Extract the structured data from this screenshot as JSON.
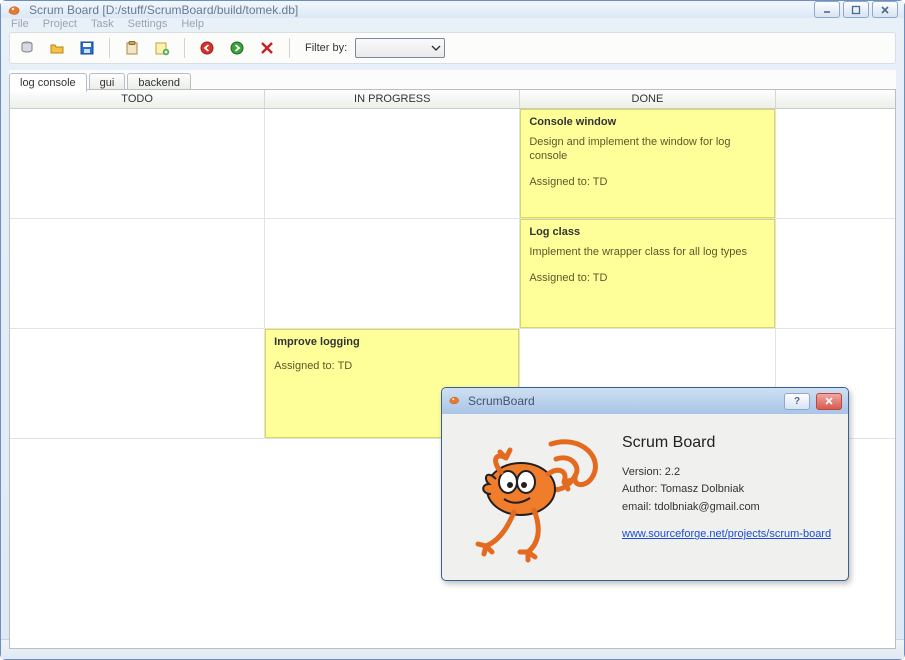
{
  "window": {
    "title": "Scrum Board [D:/stuff/ScrumBoard/build/tomek.db]"
  },
  "menu": {
    "file": "File",
    "project": "Project",
    "task": "Task",
    "settings": "Settings",
    "help": "Help"
  },
  "toolbar": {
    "filter_label": "Filter by:",
    "filter_value": ""
  },
  "tabs": [
    {
      "label": "log console",
      "active": true
    },
    {
      "label": "gui",
      "active": false
    },
    {
      "label": "backend",
      "active": false
    }
  ],
  "columns": {
    "todo": "TODO",
    "in_progress": "IN PROGRESS",
    "done": "DONE"
  },
  "cards": {
    "done_0": {
      "title": "Console window",
      "desc": "Design and implement the window for log console",
      "assigned": "Assigned to: TD"
    },
    "done_1": {
      "title": "Log class",
      "desc": "Implement the wrapper class for all log types",
      "assigned": "Assigned to: TD"
    },
    "inprog_2": {
      "title": "Improve logging",
      "desc": "",
      "assigned": "Assigned to: TD"
    }
  },
  "about": {
    "dialog_title": "ScrumBoard",
    "heading": "Scrum Board",
    "version": "Version: 2.2",
    "author": "Author: Tomasz Dolbniak",
    "email": "email: tdolbniak@gmail.com",
    "link": "www.sourceforge.net/projects/scrum-board"
  }
}
